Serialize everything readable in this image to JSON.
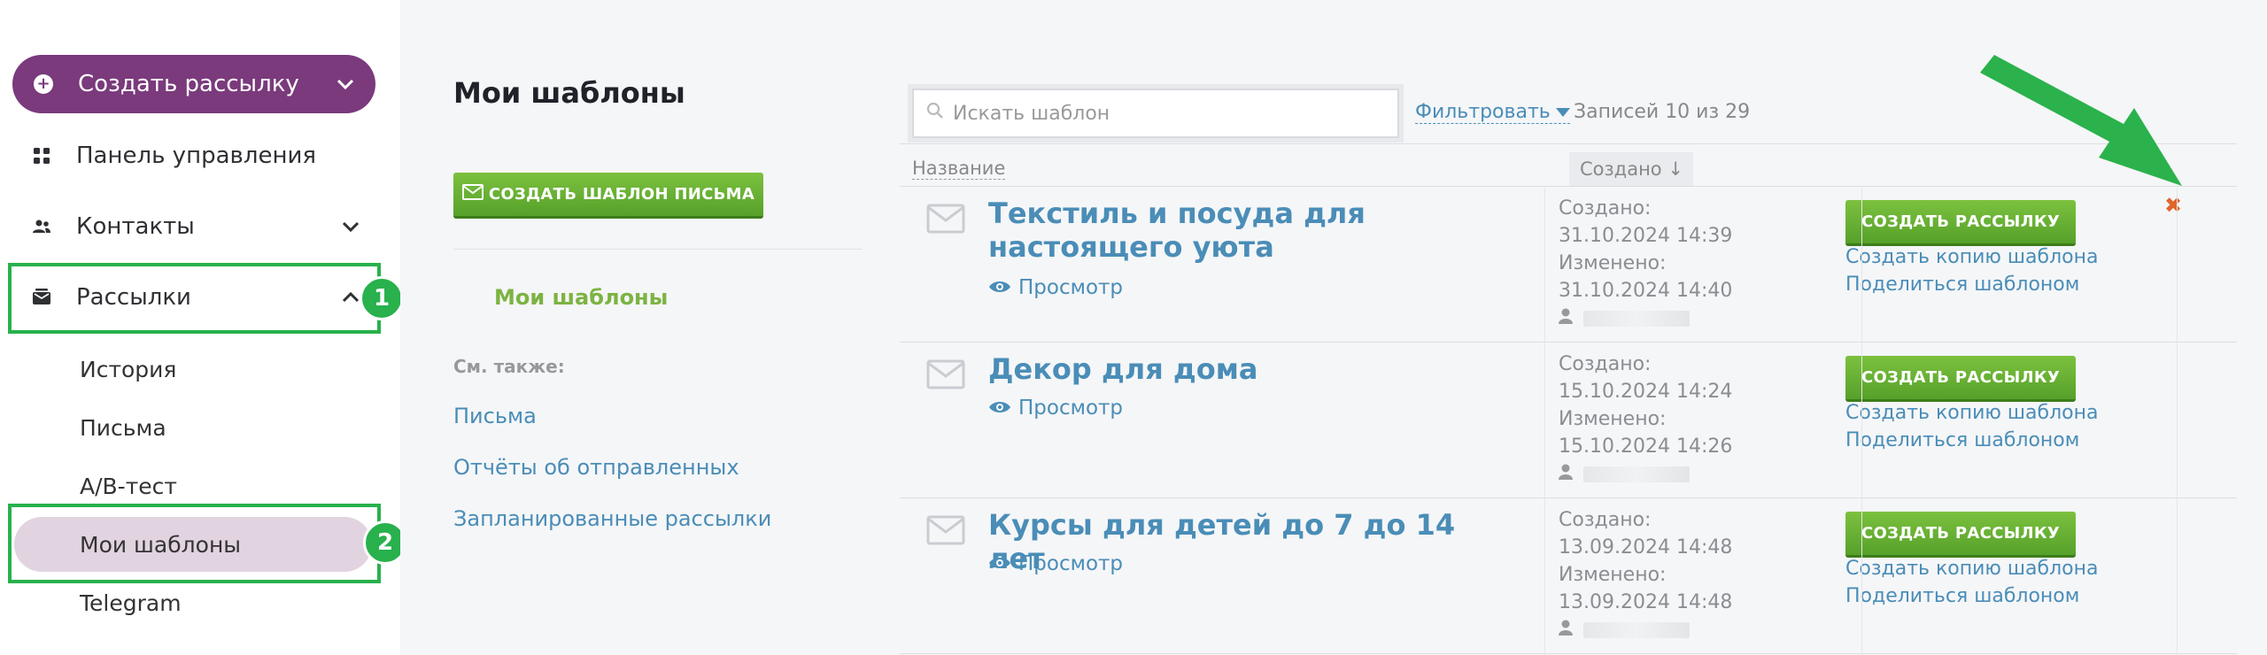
{
  "sidebar": {
    "create_label": "Создать рассылку",
    "dashboard": "Панель управления",
    "contacts": "Контакты",
    "mailings": "Рассылки",
    "sub": [
      "История",
      "Письма",
      "A/B-тест",
      "Мои шаблоны",
      "Telegram"
    ],
    "badges": [
      "1",
      "2"
    ]
  },
  "main": {
    "title": "Мои шаблоны",
    "create_template_label": "Создать шаблон письма",
    "my_templates_link": "Мои шаблоны",
    "see_also": "См. также:",
    "links": [
      "Письма",
      "Отчёты об отправленных",
      "Запланированные рассылки"
    ]
  },
  "toolbar": {
    "search_placeholder": "Искать шаблон",
    "filter_label": "Фильтровать",
    "count_label": "Записей 10 из 29"
  },
  "columns": {
    "name": "Название",
    "created": "Создано ↓"
  },
  "rows": [
    {
      "title": "Текстиль и посуда для настоящего уюта",
      "view": "Просмотр",
      "created_label": "Создано:",
      "created": "31.10.2024 14:39",
      "modified_label": "Изменено:",
      "modified": "31.10.2024 14:40",
      "action": "Создать рассылку",
      "copy": "Создать копию шаблона",
      "share": "Поделиться шаблоном"
    },
    {
      "title": "Декор для дома",
      "view": "Просмотр",
      "created_label": "Создано:",
      "created": "15.10.2024 14:24",
      "modified_label": "Изменено:",
      "modified": "15.10.2024 14:26",
      "action": "Создать рассылку",
      "copy": "Создать копию шаблона",
      "share": "Поделиться шаблоном"
    },
    {
      "title": "Курсы для детей до 7 до 14 лет",
      "view": "Просмотр",
      "created_label": "Создано:",
      "created": "13.09.2024 14:48",
      "modified_label": "Изменено:",
      "modified": "13.09.2024 14:48",
      "action": "Создать рассылку",
      "copy": "Создать копию шаблона",
      "share": "Поделиться шаблоном"
    }
  ],
  "colors": {
    "brand_purple": "#7a3a7c",
    "active_bg": "#e2d3e1",
    "highlight_green": "#28b14c",
    "link_blue": "#4a8db7",
    "button_green": "#5fa82f",
    "delete_orange": "#e0652b"
  }
}
